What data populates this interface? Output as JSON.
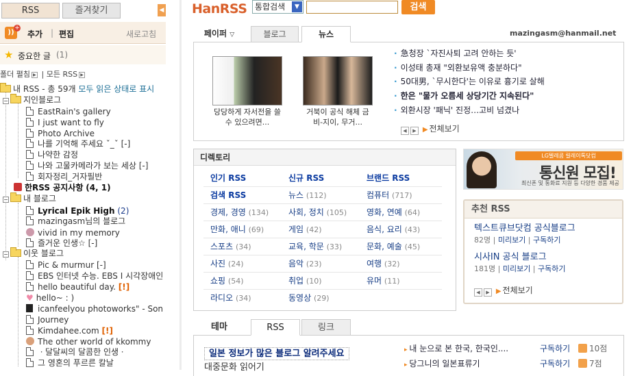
{
  "sidebar": {
    "tab_rss": "RSS",
    "tab_favorites": "즐겨찾기",
    "add_label": "추가",
    "edit_label": "편집",
    "refresh_label": "새로고침",
    "important_label": "중요한 글",
    "important_count": "(1)",
    "folder_toggle": "폴더 펼침",
    "all_rss": "모든 RSS",
    "tree": {
      "root_label": "내 RSS - 총 59개",
      "root_action": "모두 읽은 상태로 표시",
      "group1": "지인블로그",
      "group1_items": [
        "EastRain's gallery",
        "I just want to fly",
        "Photo Archive",
        "나를 기억해 주세요 ˇ_ˇ [-]",
        "나약한 감정",
        "나와 고물카메라가 보는 세상 [-]",
        "회자정리_거자필반"
      ],
      "notice_label": "한RSS 공지사항",
      "notice_count": "(4, 1)",
      "group2": "내 블로그",
      "group2_items": [
        {
          "label": "Lyrical Epik High",
          "count": "(2)"
        },
        {
          "label": "mazingasm님의 블로그",
          "count": ""
        },
        {
          "label": "vivid in my memory",
          "count": ""
        },
        {
          "label": "즐거운 인생☆ [-]",
          "count": ""
        }
      ],
      "group3": "이웃 블로그",
      "group3_items": [
        {
          "label": "Pic & murmur [-]",
          "flag": ""
        },
        {
          "label": "EBS 인터넷 수능. EBS I 시각장애인",
          "flag": ""
        },
        {
          "label": "hello beautiful day.",
          "flag": "[!]"
        },
        {
          "label": "hello~ : )",
          "flag": ""
        },
        {
          "label": "icanfeelyou photoworks\" - Son",
          "flag": ""
        },
        {
          "label": "Journey",
          "flag": ""
        },
        {
          "label": "Kimdahee.com",
          "flag": "[!]"
        },
        {
          "label": "The other world of kkommy",
          "flag": ""
        },
        {
          "label": "ㆍ달달씨의 달콤한 인생ㆍ",
          "flag": ""
        },
        {
          "label": "그 영혼의 푸르른 칼날",
          "flag": ""
        }
      ]
    }
  },
  "header": {
    "logo_han": "HanRSS",
    "search_scope": "통합검색",
    "search_value": "",
    "search_button": "검색"
  },
  "news": {
    "tab_paper": "페이퍼",
    "tab_blog": "블로그",
    "tab_news": "뉴스",
    "email": "mazingasm@hanmail.net",
    "photo1_caption": "당당하게 자서전을 쓸 수 있으려면...",
    "photo2_caption": "거북이 공식 해체 금비-지이, 무거...",
    "headlines": [
      {
        "text": "急청장 `자진사퇴 고려 안하는 듯'",
        "bold": false
      },
      {
        "text": "이성태 총재 \"외환보유액 충분하다\"",
        "bold": false
      },
      {
        "text": "50대男, `무시한다'는 이유로 흉기로 살해",
        "bold": false
      },
      {
        "text": "한은 \"물가 오름세 상당기간 지속된다\"",
        "bold": true
      },
      {
        "text": "외환시장 '패닉' 진정…고비 넘겼나",
        "bold": false
      }
    ],
    "see_all": "전체보기"
  },
  "directory": {
    "title": "디렉토리",
    "rows": [
      [
        {
          "label": "인기 RSS",
          "count": "",
          "bold": true
        },
        {
          "label": "신규 RSS",
          "count": "",
          "bold": true
        },
        {
          "label": "브랜드 RSS",
          "count": "",
          "bold": true
        }
      ],
      [
        {
          "label": "검색 RSS",
          "count": "",
          "bold": true
        },
        {
          "label": "뉴스",
          "count": "(112)",
          "bold": false
        },
        {
          "label": "컴퓨터",
          "count": "(717)",
          "bold": false
        }
      ],
      [
        {
          "label": "경제, 경영",
          "count": "(134)",
          "bold": false
        },
        {
          "label": "사회, 정치",
          "count": "(105)",
          "bold": false
        },
        {
          "label": "영화, 연예",
          "count": "(64)",
          "bold": false
        }
      ],
      [
        {
          "label": "만화, 애니",
          "count": "(69)",
          "bold": false
        },
        {
          "label": "게임",
          "count": "(42)",
          "bold": false
        },
        {
          "label": "음식, 요리",
          "count": "(43)",
          "bold": false
        }
      ],
      [
        {
          "label": "스포츠",
          "count": "(34)",
          "bold": false
        },
        {
          "label": "교육, 학문",
          "count": "(33)",
          "bold": false
        },
        {
          "label": "문화, 예술",
          "count": "(45)",
          "bold": false
        }
      ],
      [
        {
          "label": "사진",
          "count": "(24)",
          "bold": false
        },
        {
          "label": "음악",
          "count": "(23)",
          "bold": false
        },
        {
          "label": "여행",
          "count": "(32)",
          "bold": false
        }
      ],
      [
        {
          "label": "쇼핑",
          "count": "(54)",
          "bold": false
        },
        {
          "label": "취업",
          "count": "(10)",
          "bold": false
        },
        {
          "label": "유머",
          "count": "(11)",
          "bold": false
        }
      ],
      [
        {
          "label": "라디오",
          "count": "(34)",
          "bold": false
        },
        {
          "label": "동영상",
          "count": "(29)",
          "bold": false
        },
        {
          "label": "",
          "count": "",
          "bold": false
        }
      ]
    ]
  },
  "ad": {
    "line1": "LG텔레콤 릴레이톡닷컴",
    "line2": "통신원 모집!",
    "line3": "최신폰 및 통화료 지원 등 다양한 경품 제공"
  },
  "recommend": {
    "title": "추천 RSS",
    "items": [
      {
        "name": "텍스트큐브닷컴 공식블로그",
        "subs": "82명",
        "preview": "미리보기",
        "subscribe": "구독하기"
      },
      {
        "name": "시사IN 공식 블로그",
        "subs": "181명",
        "preview": "미리보기",
        "subscribe": "구독하기"
      }
    ],
    "see_all": "전체보기"
  },
  "bottom": {
    "tab_theme": "테마",
    "tab_rss": "RSS",
    "tab_link": "링크",
    "highlight": "일본 정보가 많은 블로그 알려주세요",
    "second": "대중문화 읽어기",
    "items": [
      {
        "title": "내 눈으로 본 한국, 한국인....",
        "action": "구독하기",
        "score": "10점"
      },
      {
        "title": "당그니의 일본표류기",
        "action": "구독하기",
        "score": "7점"
      }
    ]
  }
}
